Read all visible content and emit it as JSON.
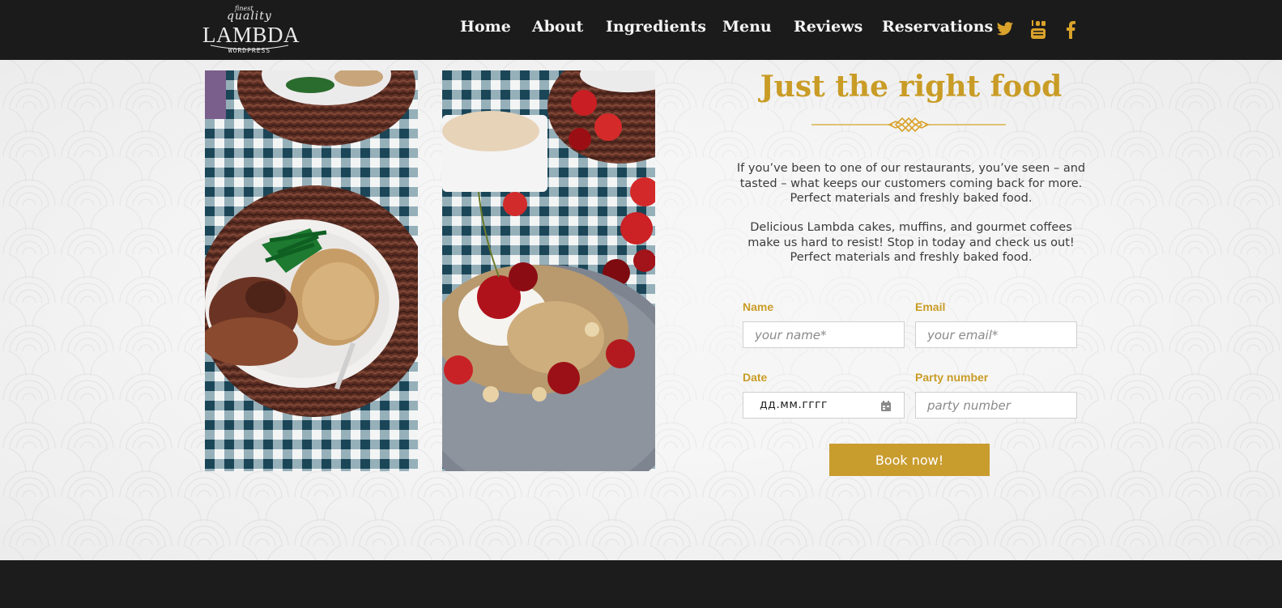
{
  "logo": {
    "finest": "finest",
    "quality": "quality",
    "brand": "LAMBDA",
    "subtitle": "WORDPRESS"
  },
  "nav": {
    "items": [
      "Home",
      "About",
      "Ingredients",
      "Menu",
      "Reviews",
      "Reservations"
    ]
  },
  "social": [
    "twitter-icon",
    "youtube-icon",
    "facebook-icon"
  ],
  "colors": {
    "accent": "#c99c26",
    "header_bg": "#1b1b1b",
    "button": "#c99c2e"
  },
  "main": {
    "heading": "Just the right food",
    "paragraph1": [
      "If you’ve been to one of our restaurants, you’ve seen – and",
      "tasted – what keeps our customers coming back for more.",
      "Perfect materials and freshly baked food."
    ],
    "paragraph2": [
      "Delicious Lambda cakes, muffins, and gourmet coffees",
      "make us hard to resist! Stop in today and check us out!",
      "Perfect materials and freshly baked food."
    ]
  },
  "form": {
    "name_label": "Name",
    "name_placeholder": "your name*",
    "email_label": "Email",
    "email_placeholder": "your email*",
    "date_label": "Date",
    "date_value": "дд.мм.гггг",
    "party_label": "Party number",
    "party_placeholder": "party number",
    "submit_label": "Book now!"
  }
}
